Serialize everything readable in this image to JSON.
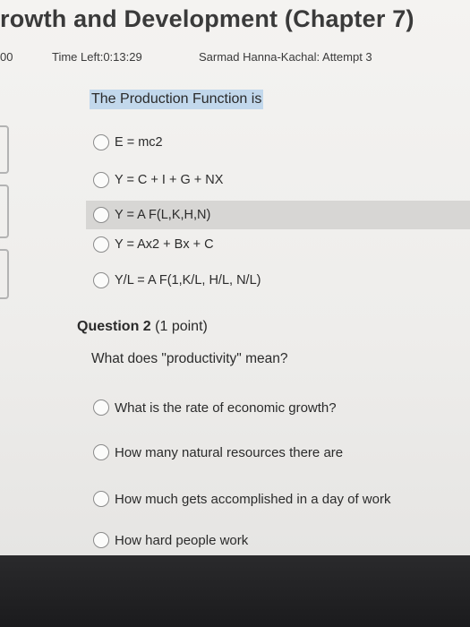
{
  "header": {
    "course_title": "rowth and Development (Chapter 7)",
    "score_fragment": "00",
    "time_left": "Time Left:0:13:29",
    "attempt": "Sarmad Hanna-Kachal: Attempt 3"
  },
  "question1": {
    "prompt": "The Production Function is",
    "options": [
      "E = mc2",
      "Y = C + I + G + NX",
      "Y = A F(L,K,H,N)",
      "Y = Ax2 + Bx + C",
      "Y/L = A F(1,K/L, H/L, N/L)"
    ]
  },
  "question2": {
    "label": "Question 2",
    "points": "(1 point)",
    "prompt": "What does \"productivity\" mean?",
    "options": [
      "What is the rate of economic growth?",
      "How many natural resources there are",
      "How much gets accomplished in a day of work",
      "How hard people work"
    ]
  }
}
